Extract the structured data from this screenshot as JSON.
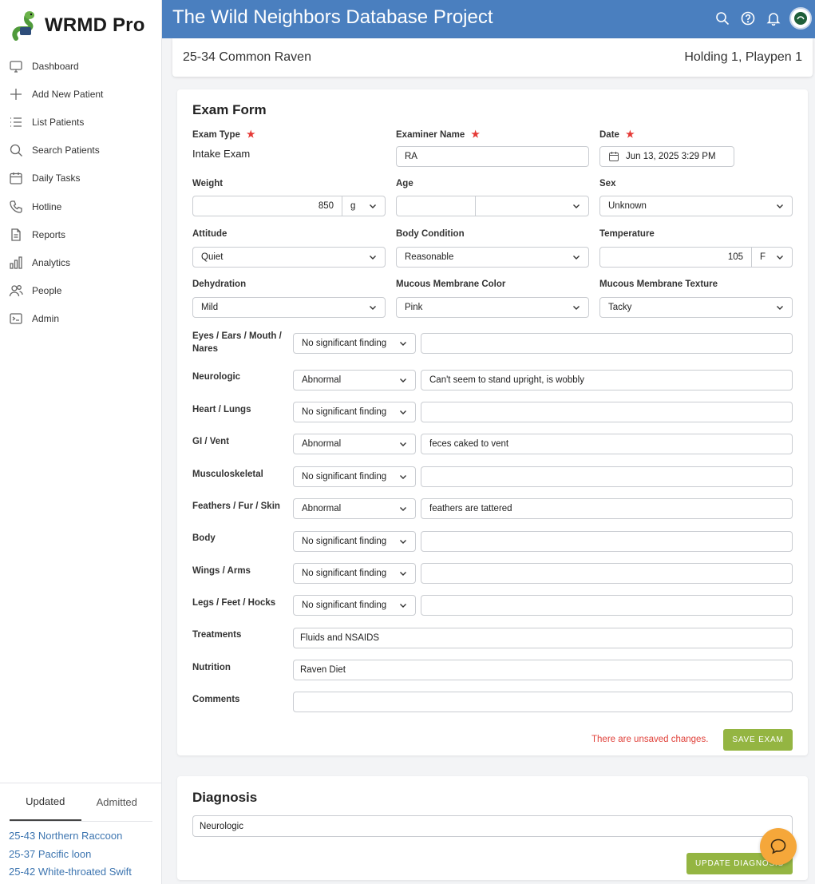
{
  "app": {
    "brand": "WRMD Pro",
    "header_title": "The Wild Neighbors Database Project"
  },
  "sidebar": {
    "items": [
      {
        "label": "Dashboard",
        "icon": "monitor-icon"
      },
      {
        "label": "Add New Patient",
        "icon": "plus-icon"
      },
      {
        "label": "List Patients",
        "icon": "list-icon"
      },
      {
        "label": "Search Patients",
        "icon": "search-icon"
      },
      {
        "label": "Daily Tasks",
        "icon": "calendar-icon"
      },
      {
        "label": "Hotline",
        "icon": "phone-icon"
      },
      {
        "label": "Reports",
        "icon": "document-icon"
      },
      {
        "label": "Analytics",
        "icon": "bar-chart-icon"
      },
      {
        "label": "People",
        "icon": "people-icon"
      },
      {
        "label": "Admin",
        "icon": "terminal-icon"
      }
    ],
    "recent_tabs": [
      "Updated",
      "Admitted"
    ],
    "recent_patients": [
      "25-43 Northern Raccoon",
      "25-37 Pacific loon",
      "25-42 White-throated Swift"
    ]
  },
  "patient": {
    "name": "25-34 Common Raven",
    "location": "Holding 1, Playpen 1"
  },
  "exam": {
    "heading": "Exam Form",
    "exam_type_label": "Exam Type",
    "exam_type_value": "Intake Exam",
    "examiner_label": "Examiner Name",
    "examiner_value": "RA",
    "date_label": "Date",
    "date_value": "Jun 13, 2025 3:29 PM",
    "weight_label": "Weight",
    "weight_value": "850",
    "weight_unit": "g",
    "age_label": "Age",
    "age_value": "",
    "age_unit": "",
    "sex_label": "Sex",
    "sex_value": "Unknown",
    "attitude_label": "Attitude",
    "attitude_value": "Quiet",
    "body_condition_label": "Body Condition",
    "body_condition_value": "Reasonable",
    "temperature_label": "Temperature",
    "temperature_value": "105",
    "temperature_unit": "F",
    "dehydration_label": "Dehydration",
    "dehydration_value": "Mild",
    "mm_color_label": "Mucous Membrane Color",
    "mm_color_value": "Pink",
    "mm_texture_label": "Mucous Membrane Texture",
    "mm_texture_value": "Tacky",
    "systems": [
      {
        "label": "Eyes / Ears / Mouth / Nares",
        "finding": "No significant finding",
        "note": ""
      },
      {
        "label": "Neurologic",
        "finding": "Abnormal",
        "note": "Can't seem to stand upright, is wobbly"
      },
      {
        "label": "Heart / Lungs",
        "finding": "No significant finding",
        "note": ""
      },
      {
        "label": "GI / Vent",
        "finding": "Abnormal",
        "note": "feces caked to vent"
      },
      {
        "label": "Musculoskeletal",
        "finding": "No significant finding",
        "note": ""
      },
      {
        "label": "Feathers / Fur / Skin",
        "finding": "Abnormal",
        "note": "feathers are tattered"
      },
      {
        "label": "Body",
        "finding": "No significant finding",
        "note": ""
      },
      {
        "label": "Wings / Arms",
        "finding": "No significant finding",
        "note": ""
      },
      {
        "label": "Legs / Feet / Hocks",
        "finding": "No significant finding",
        "note": ""
      }
    ],
    "treatments_label": "Treatments",
    "treatments_value": "Fluids and NSAIDS",
    "nutrition_label": "Nutrition",
    "nutrition_value": "Raven Diet",
    "comments_label": "Comments",
    "comments_value": "",
    "unsaved_text": "There are unsaved changes.",
    "save_label": "SAVE EXAM"
  },
  "diagnosis": {
    "heading": "Diagnosis",
    "value": "Neurologic",
    "update_label": "UPDATE DIAGNOSIS"
  },
  "colors": {
    "header": "#4a7fbf",
    "accent_button": "#94b542",
    "required": "#e53935",
    "link": "#3d75b0",
    "chat": "#f5a73a"
  }
}
